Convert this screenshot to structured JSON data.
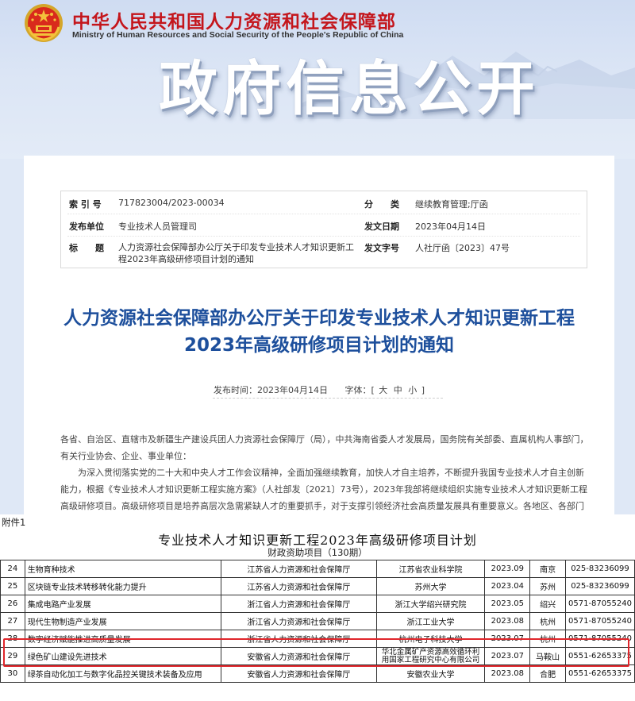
{
  "header": {
    "ministry_cn": "中华人民共和国人力资源和社会保障部",
    "ministry_en": "Ministry of Human Resources and Social Security of the People's Republic of China",
    "section_title": "政府信息公开",
    "brand_red": "#c4161c"
  },
  "meta": {
    "index_label": "索 引 号",
    "index_value": "717823004/2023-00034",
    "category_label": "分　　类",
    "category_value": "继续教育管理;厅函",
    "issuer_label": "发布单位",
    "issuer_value": "专业技术人员管理司",
    "date_label": "发文日期",
    "date_value": "2023年04月14日",
    "title_label": "标　　题",
    "title_value": "人力资源社会保障部办公厅关于印发专业技术人才知识更新工程2023年高级研修项目计划的通知",
    "docno_label": "发文字号",
    "docno_value": "人社厅函〔2023〕47号"
  },
  "document": {
    "title": "人力资源社会保障部办公厅关于印发专业技术人才知识更新工程2023年高级研修项目计划的通知",
    "title_color": "#1d4f9c",
    "publish_label": "发布时间：2023年04月14日",
    "font_label": "字体：[",
    "font_large": "大",
    "font_medium": "中",
    "font_small": "小",
    "font_close": "]",
    "para1": "各省、自治区、直辖市及新疆生产建设兵团人力资源社会保障厅（局），中共海南省委人才发展局，国务院有关部委、直属机构人事部门，有关行业协会、企业、事业单位：",
    "para2": "为深入贯彻落实党的二十大和中央人才工作会议精神，全面加强继续教育，加快人才自主培养，不断提升我国专业技术人才自主创新能力，根据《专业技术人才知识更新工程实施方案》（人社部发〔2021〕73号），2023年我部将继续组织实施专业技术人才知识更新工程高级研修项目。高级研修项目是培养高层次急需紧缺人才的重要抓手，对于支撑引领经济社会高质量发展具有重要意义。各地区、各部门"
  },
  "attachment": {
    "label": "附件1",
    "title": "专业技术人才知识更新工程2023年高级研修项目计划",
    "subtitle": "财政资助项目（130期）",
    "highlight_color": "#e0262b",
    "rows": [
      {
        "no": "24",
        "project": "生物育种技术",
        "dept": "江苏省人力资源和社会保障厅",
        "host": "江苏省农业科学院",
        "date": "2023.09",
        "city": "南京",
        "phone": "025-83236099"
      },
      {
        "no": "25",
        "project": "区块链专业技术转移转化能力提升",
        "dept": "江苏省人力资源和社会保障厅",
        "host": "苏州大学",
        "date": "2023.04",
        "city": "苏州",
        "phone": "025-83236099"
      },
      {
        "no": "26",
        "project": "集成电路产业发展",
        "dept": "浙江省人力资源和社会保障厅",
        "host": "浙江大学绍兴研究院",
        "date": "2023.05",
        "city": "绍兴",
        "phone": "0571-87055240"
      },
      {
        "no": "27",
        "project": "现代生物制造产业发展",
        "dept": "浙江省人力资源和社会保障厅",
        "host": "浙江工业大学",
        "date": "2023.08",
        "city": "杭州",
        "phone": "0571-87055240"
      },
      {
        "no": "28",
        "project": "数字经济赋能推进高质量发展",
        "dept": "浙江省人力资源和社会保障厅",
        "host": "杭州电子科技大学",
        "date": "2023.07",
        "city": "杭州",
        "phone": "0571-87055240"
      },
      {
        "no": "29",
        "project": "绿色矿山建设先进技术",
        "dept": "安徽省人力资源和社会保障厅",
        "host": "华北金属矿产资源高效循环利用国家工程研究中心有限公司",
        "date": "2023.07",
        "city": "马鞍山",
        "phone": "0551-62653375"
      },
      {
        "no": "30",
        "project": "绿茶自动化加工与数字化品控关键技术装备及应用",
        "dept": "安徽省人力资源和社会保障厅",
        "host": "安徽农业大学",
        "date": "2023.08",
        "city": "合肥",
        "phone": "0551-62653375"
      }
    ]
  }
}
